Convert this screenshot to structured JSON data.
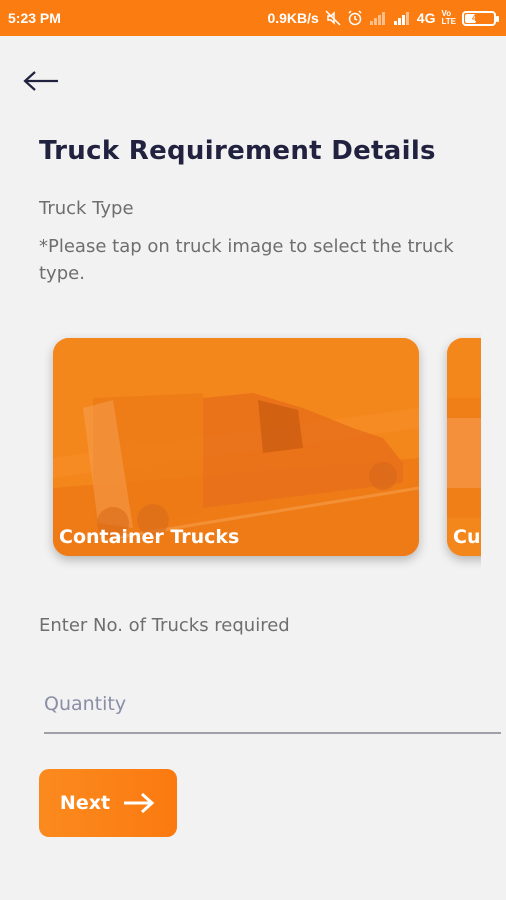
{
  "status_bar": {
    "time": "5:23 PM",
    "speed": "0.9KB/s",
    "network": "4G",
    "volte_top": "Vo",
    "volte_bottom": "LTE",
    "battery": "41",
    "icons": [
      "mute-icon",
      "alarm-icon",
      "signal-icon",
      "signal-icon",
      "battery-icon"
    ]
  },
  "header": {
    "back_icon": "arrow-left-icon",
    "title": "Truck Requirement Details"
  },
  "truck_type": {
    "label": "Truck Type",
    "hint": "*Please tap on truck image to select the truck type.",
    "cards": [
      {
        "label": "Container Trucks"
      },
      {
        "label": "Cur"
      }
    ]
  },
  "quantity": {
    "label": "Enter No. of Trucks required",
    "placeholder": "Quantity",
    "value": ""
  },
  "actions": {
    "next_label": "Next",
    "next_icon": "arrow-right-icon"
  },
  "colors": {
    "accent": "#fb7d12",
    "title": "#20223f",
    "text": "#6e6e6e",
    "background": "#f2f2f2"
  }
}
